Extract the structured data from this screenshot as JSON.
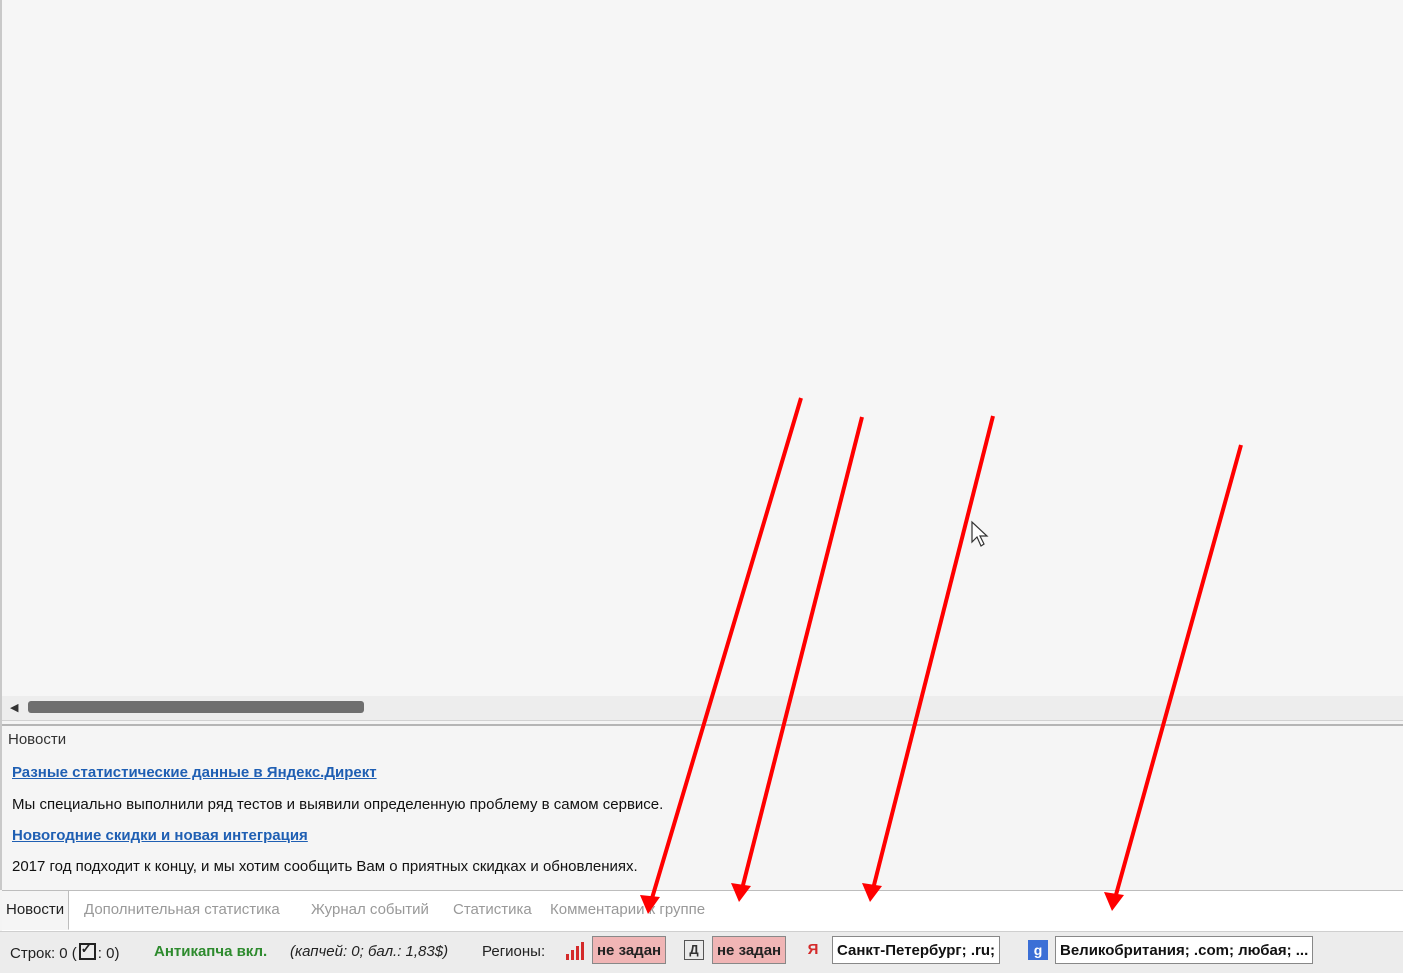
{
  "news": {
    "title": "Новости",
    "items": [
      {
        "link": "Разные статистические данные в Яндекс.Директ",
        "text": "Мы специально выполнили ряд тестов и выявили определенную проблему в самом сервисе."
      },
      {
        "link": "Новогодние скидки и новая интеграция",
        "text": "2017 год подходит к концу, и мы хотим сообщить Вам о приятных скидках и обновлениях."
      }
    ]
  },
  "tabs": [
    "Новости",
    "Дополнительная статистика",
    "Журнал событий",
    "Статистика",
    "Комментарии к группе"
  ],
  "status": {
    "rows_prefix": "Строк: 0 (",
    "rows_suffix": ": 0)",
    "anticaptcha": "Антикапча вкл.",
    "anticaptcha_info": "(капчей: 0; бал.: 1,83$)",
    "regions_label": "Регионы:",
    "region_1": "не задан",
    "region_2": "не задан",
    "region_3": "Санкт-Петербург; .ru;",
    "region_4": "Великобритания; .com; любая; ..."
  },
  "colors": {
    "link": "#1f5fb3",
    "anticaptcha": "#2e8b2e",
    "badge_unset": "#f0b5b5",
    "annotation_arrows": "#ff0000"
  },
  "icons": [
    "bars-icon",
    "document-icon",
    "yandex-icon",
    "google-icon",
    "checkbox-icon",
    "cursor-icon"
  ]
}
